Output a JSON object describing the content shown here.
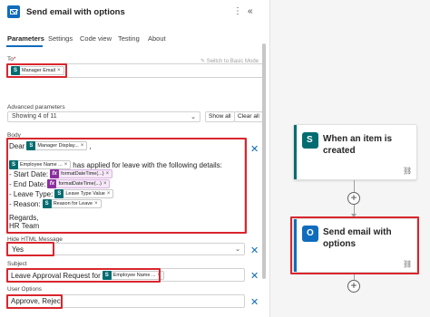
{
  "header": {
    "title": "Send email with options",
    "more_icon": "more-vertical-icon",
    "collapse_icon": "double-chevron-left-icon"
  },
  "tabs": [
    {
      "label": "Parameters",
      "active": true
    },
    {
      "label": "Settings"
    },
    {
      "label": "Code view"
    },
    {
      "label": "Testing"
    },
    {
      "label": "About"
    }
  ],
  "to": {
    "label": "To",
    "required_mark": "*",
    "switch_label": "Switch to Basic Mode",
    "token": "Manager Email"
  },
  "advanced": {
    "label": "Advanced parameters",
    "selected": "Showing 4 of 11",
    "show_all": "Show all",
    "clear_all": "Clear all"
  },
  "body": {
    "label": "Body",
    "dear": "Dear",
    "dear_token": "Manager Display...",
    "dear_suffix": ",",
    "employee_token": "Employee Name ...",
    "applied_text": "has applied for leave with the following details:",
    "start_label": "- Start Date:",
    "start_token": "formatDateTime(...)",
    "end_label": "- End Date:",
    "end_token": "formatDateTime(...)",
    "type_label": "- Leave Type:",
    "type_token": "Leave Type Value",
    "reason_label": "- Reason:",
    "reason_token": "Reason for Leave",
    "regards": "Regards,",
    "team": "HR Team"
  },
  "hide_html": {
    "label": "Hide HTML Message",
    "value": "Yes"
  },
  "subject": {
    "label": "Subject",
    "prefix": "Leave Approval Request for",
    "token": "Employee Name ..."
  },
  "user_options": {
    "label": "User Options",
    "value": "Approve, Reject"
  },
  "canvas": {
    "trigger_title_1": "When an item is",
    "trigger_title_2": "created",
    "action_title_1": "Send email with",
    "action_title_2": "options"
  },
  "colors": {
    "accent": "#0f6cbd",
    "highlight": "#d9262e",
    "sharepoint": "#036c70",
    "expression": "#8b2f9e"
  }
}
